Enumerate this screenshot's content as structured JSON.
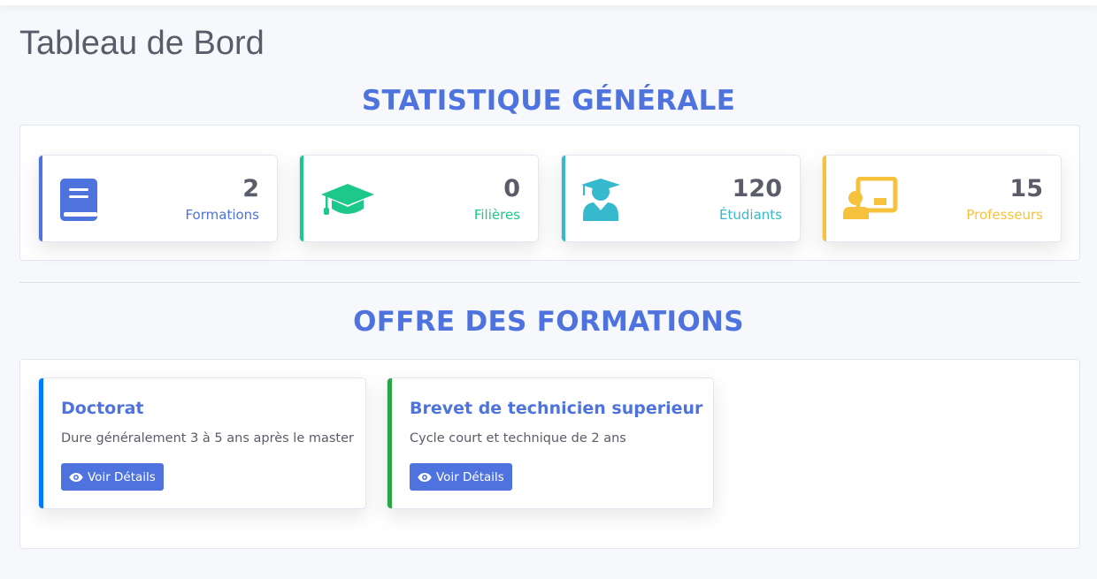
{
  "page": {
    "title": "Tableau de Bord"
  },
  "stats_section": {
    "heading": "STATISTIQUE GÉNÉRALE",
    "cards": [
      {
        "value": "2",
        "label": "Formations",
        "icon": "book-icon",
        "color": "#4e73df"
      },
      {
        "value": "0",
        "label": "Filières",
        "icon": "graduation-cap-icon",
        "color": "#1cc88a"
      },
      {
        "value": "120",
        "label": "Étudiants",
        "icon": "user-graduate-icon",
        "color": "#36b9cc"
      },
      {
        "value": "15",
        "label": "Professeurs",
        "icon": "chalkboard-teacher-icon",
        "color": "#f6c23e"
      }
    ]
  },
  "offers_section": {
    "heading": "OFFRE DES FORMATIONS",
    "cards": [
      {
        "title": "Doctorat",
        "description": "Dure généralement 3 à 5 ans après le master",
        "button_label": "Voir Détails",
        "accent": "#007bff"
      },
      {
        "title": "Brevet de technicien superieur",
        "description": "Cycle court et technique de 2 ans",
        "button_label": "Voir Détails",
        "accent": "#28a745"
      }
    ]
  },
  "colors": {
    "primary": "#4e73df",
    "text": "#5a5c69",
    "background": "#f7f8fc"
  }
}
